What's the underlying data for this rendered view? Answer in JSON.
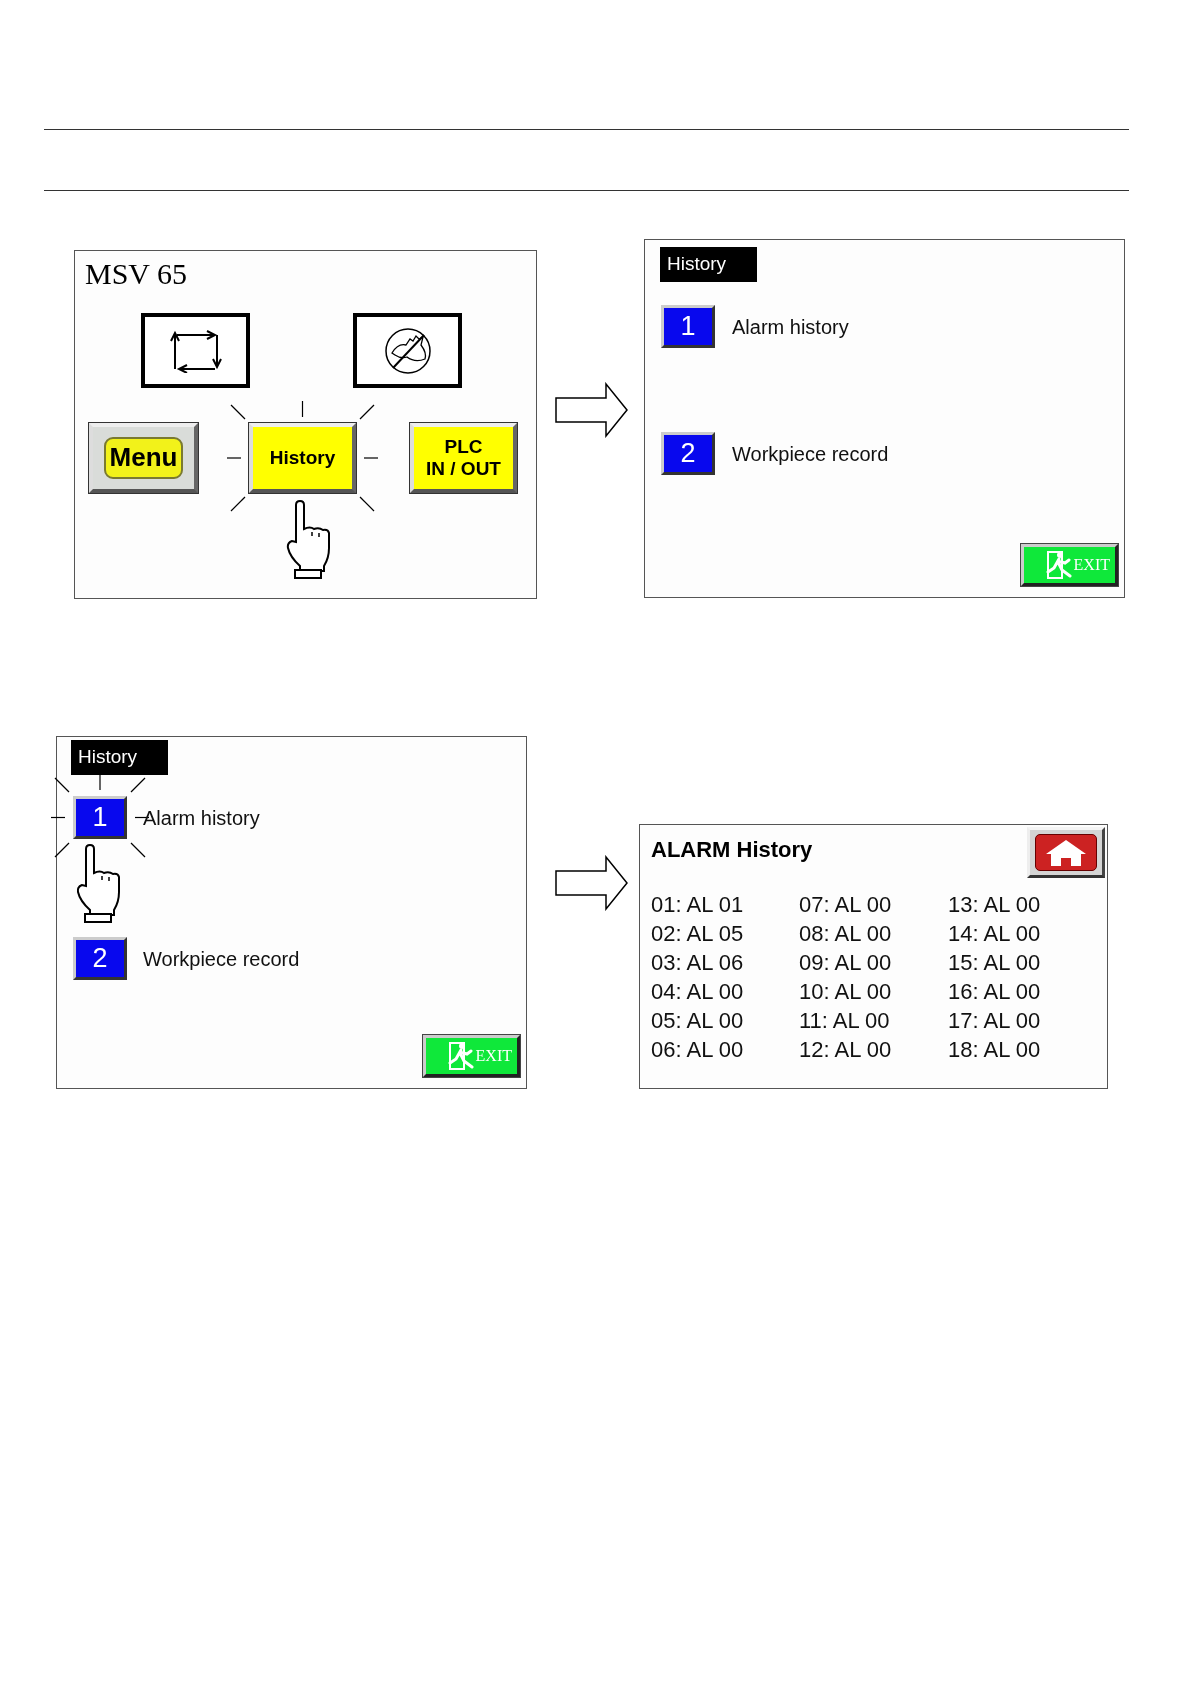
{
  "screens": [
    {
      "kind": "main",
      "title": "MSV 65",
      "buttons": [
        {
          "label": "Menu",
          "kind": "rounded",
          "pressed": false
        },
        {
          "label": "History",
          "kind": "square",
          "pressed": true
        },
        {
          "label": "PLC\nIN / OUT",
          "kind": "square",
          "pressed": false
        }
      ]
    },
    {
      "kind": "menu",
      "title": "History",
      "items": [
        {
          "number": "1",
          "label": "Alarm history",
          "pressed": false
        },
        {
          "number": "2",
          "label": "Workpiece record",
          "pressed": false
        }
      ],
      "exit": "EXIT"
    },
    {
      "kind": "menu",
      "title": "History",
      "items": [
        {
          "number": "1",
          "label": "Alarm history",
          "pressed": true
        },
        {
          "number": "2",
          "label": "Workpiece record",
          "pressed": false
        }
      ],
      "exit": "EXIT"
    },
    {
      "kind": "alarm",
      "title": "ALARM History",
      "entries": [
        "01: AL 01",
        "02: AL 05",
        "03: AL 06",
        "04: AL 00",
        "05: AL 00",
        "06: AL 00",
        "07: AL 00",
        "08: AL 00",
        "09: AL 00",
        "10: AL 00",
        "11: AL 00",
        "12: AL 00",
        "13: AL 00",
        "14: AL 00",
        "15: AL 00",
        "16: AL 00",
        "17: AL 00",
        "18: AL 00"
      ]
    }
  ]
}
